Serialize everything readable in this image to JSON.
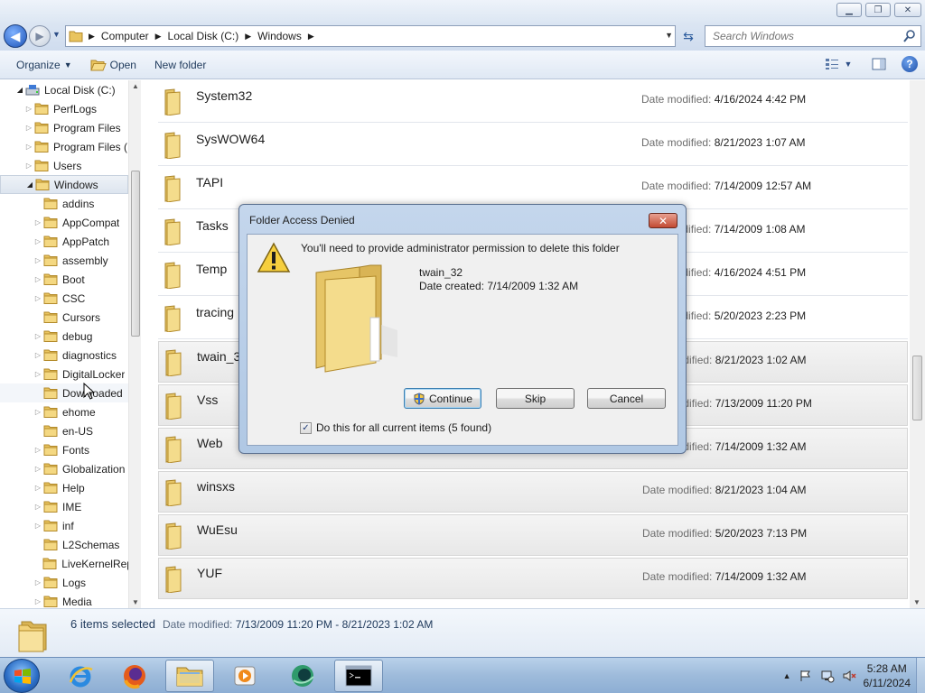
{
  "window": {
    "minimize_icon": "minimize-icon",
    "maximize_icon": "restore-icon",
    "close_icon": "close-icon"
  },
  "address": {
    "crumbs": [
      "Computer",
      "Local Disk (C:)",
      "Windows"
    ],
    "search_placeholder": "Search Windows"
  },
  "toolbar": {
    "organize": "Organize",
    "open": "Open",
    "new_folder": "New folder"
  },
  "tree": {
    "root": "Local Disk (C:)",
    "items": [
      {
        "label": "PerfLogs",
        "level": 1,
        "arrow": "closed"
      },
      {
        "label": "Program Files",
        "level": 1,
        "arrow": "closed"
      },
      {
        "label": "Program Files (",
        "level": 1,
        "arrow": "closed"
      },
      {
        "label": "Users",
        "level": 1,
        "arrow": "closed"
      },
      {
        "label": "Windows",
        "level": 1,
        "arrow": "open"
      },
      {
        "label": "addins",
        "level": 2,
        "arrow": "none"
      },
      {
        "label": "AppCompat",
        "level": 2,
        "arrow": "closed"
      },
      {
        "label": "AppPatch",
        "level": 2,
        "arrow": "closed"
      },
      {
        "label": "assembly",
        "level": 2,
        "arrow": "closed"
      },
      {
        "label": "Boot",
        "level": 2,
        "arrow": "closed"
      },
      {
        "label": "CSC",
        "level": 2,
        "arrow": "closed"
      },
      {
        "label": "Cursors",
        "level": 2,
        "arrow": "none"
      },
      {
        "label": "debug",
        "level": 2,
        "arrow": "closed"
      },
      {
        "label": "diagnostics",
        "level": 2,
        "arrow": "closed"
      },
      {
        "label": "DigitalLocker",
        "level": 2,
        "arrow": "closed"
      },
      {
        "label": "Downloaded",
        "level": 2,
        "arrow": "none"
      },
      {
        "label": "ehome",
        "level": 2,
        "arrow": "closed"
      },
      {
        "label": "en-US",
        "level": 2,
        "arrow": "none"
      },
      {
        "label": "Fonts",
        "level": 2,
        "arrow": "closed"
      },
      {
        "label": "Globalization",
        "level": 2,
        "arrow": "closed"
      },
      {
        "label": "Help",
        "level": 2,
        "arrow": "closed"
      },
      {
        "label": "IME",
        "level": 2,
        "arrow": "closed"
      },
      {
        "label": "inf",
        "level": 2,
        "arrow": "closed"
      },
      {
        "label": "L2Schemas",
        "level": 2,
        "arrow": "none"
      },
      {
        "label": "LiveKernelRep",
        "level": 2,
        "arrow": "none"
      },
      {
        "label": "Logs",
        "level": 2,
        "arrow": "closed"
      },
      {
        "label": "Media",
        "level": 2,
        "arrow": "closed"
      }
    ]
  },
  "files": {
    "date_label": "Date modified:",
    "rows": [
      {
        "name": "System32",
        "date": "4/16/2024 4:42 PM",
        "selected": false
      },
      {
        "name": "SysWOW64",
        "date": "8/21/2023 1:07 AM",
        "selected": false
      },
      {
        "name": "TAPI",
        "date": "7/14/2009 12:57 AM",
        "selected": false
      },
      {
        "name": "Tasks",
        "date": "7/14/2009 1:08 AM",
        "selected": false
      },
      {
        "name": "Temp",
        "date": "4/16/2024 4:51 PM",
        "selected": false
      },
      {
        "name": "tracing",
        "date": "5/20/2023 2:23 PM",
        "selected": false
      },
      {
        "name": "twain_32",
        "date": "8/21/2023 1:02 AM",
        "selected": true
      },
      {
        "name": "Vss",
        "date": "7/13/2009 11:20 PM",
        "selected": true
      },
      {
        "name": "Web",
        "date": "7/14/2009 1:32 AM",
        "selected": true
      },
      {
        "name": "winsxs",
        "date": "8/21/2023 1:04 AM",
        "selected": true
      },
      {
        "name": "WuEsu",
        "date": "5/20/2023 7:13 PM",
        "selected": true
      },
      {
        "name": "YUF",
        "date": "7/14/2009 1:32 AM",
        "selected": true
      }
    ]
  },
  "details": {
    "count": "6 items selected",
    "date_label": "Date modified:",
    "date_range": "7/13/2009 11:20 PM - 8/21/2023 1:02 AM"
  },
  "dialog": {
    "title": "Folder Access Denied",
    "message": "You'll need to provide administrator permission to delete this folder",
    "item_name": "twain_32",
    "item_created": "Date created: 7/14/2009 1:32 AM",
    "continue": "Continue",
    "skip": "Skip",
    "cancel": "Cancel",
    "checkbox_label": "Do this for all current items (5 found)",
    "checkbox_checked": true
  },
  "taskbar": {
    "time": "5:28 AM",
    "date": "6/11/2024",
    "apps": [
      "internet-explorer-icon",
      "firefox-icon",
      "explorer-folder-icon",
      "media-player-icon",
      "green-globe-app-icon",
      "command-prompt-icon"
    ]
  },
  "colors": {
    "selection": "#e8e8e8",
    "dialog_frame": "#b0c8e4",
    "folder": "#f2d27a"
  }
}
